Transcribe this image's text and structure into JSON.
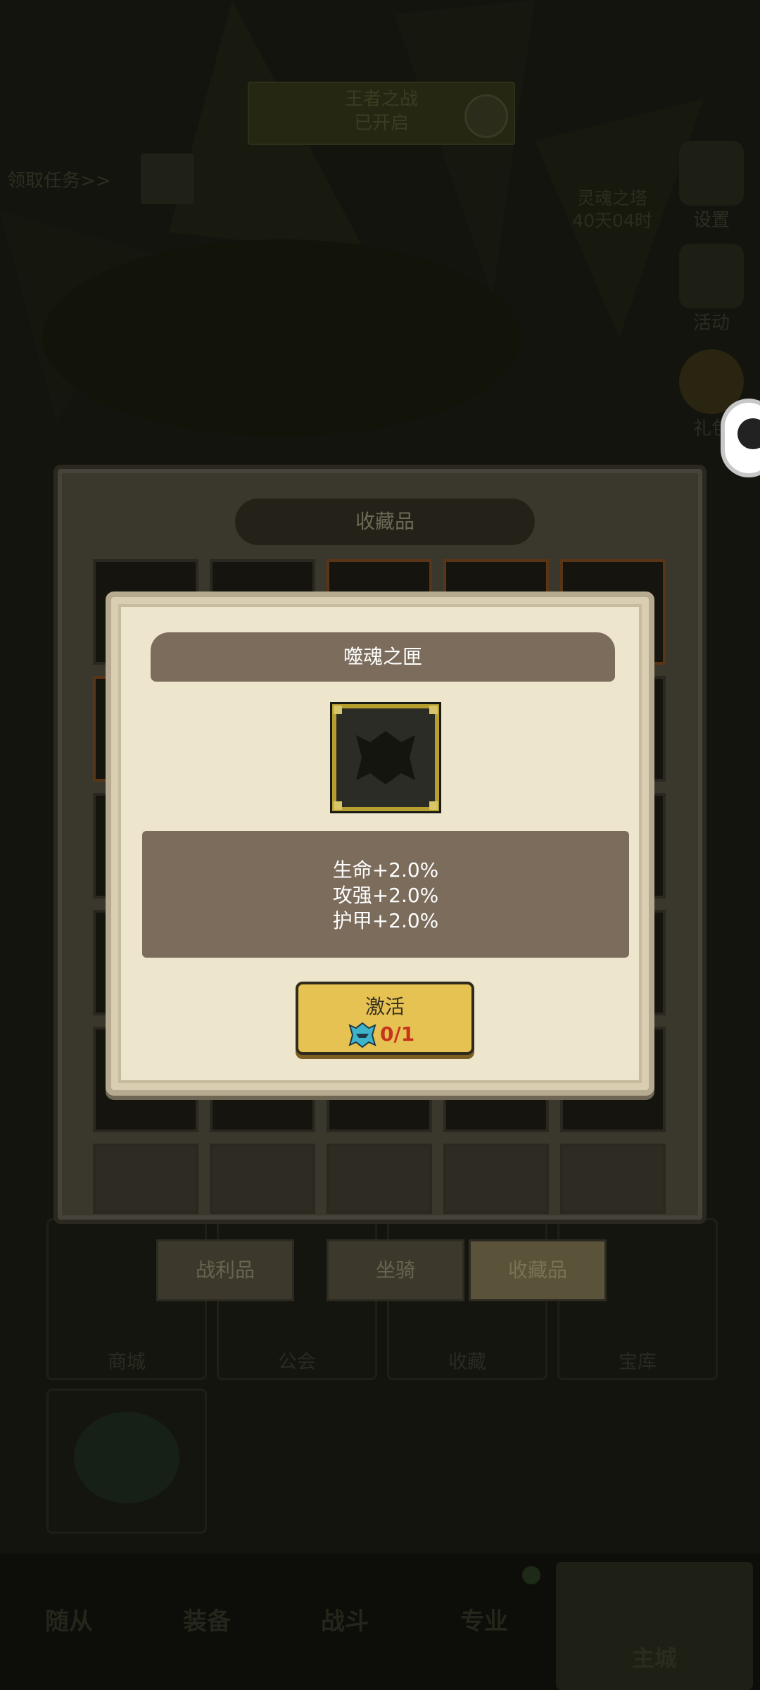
{
  "background": {
    "top_banner": {
      "line1": "王者之战",
      "line2": "已开启"
    },
    "task_tip": "领取任务>>",
    "season": {
      "name": "灵魂之塔",
      "remaining": "40天04时"
    },
    "side_buttons": [
      "设置",
      "活动",
      "礼包"
    ],
    "bottom_cards": [
      "商城",
      "公会",
      "收藏",
      "宝库"
    ],
    "nav": [
      "随从",
      "装备",
      "战斗",
      "专业",
      "主城"
    ]
  },
  "collection_panel": {
    "title": "收藏品",
    "tabs": [
      {
        "label": "战利品",
        "active": false
      },
      {
        "label": "坐骑",
        "active": false
      },
      {
        "label": "收藏品",
        "active": true
      }
    ]
  },
  "dialog": {
    "title": "噬魂之匣",
    "item_icon": "soul-box-icon",
    "stats": [
      "生命+2.0%",
      "攻强+2.0%",
      "护甲+2.0%"
    ],
    "activate": {
      "label": "激活",
      "cost_icon": "soul-box-token-icon",
      "cost": "0/1"
    }
  },
  "colors": {
    "dialog_bg": "#ece4cc",
    "dialog_header": "#7b6c5c",
    "button_gold": "#e6c253",
    "cost_red": "#c7341c",
    "icon_frame_gold": "#b69e2f"
  }
}
